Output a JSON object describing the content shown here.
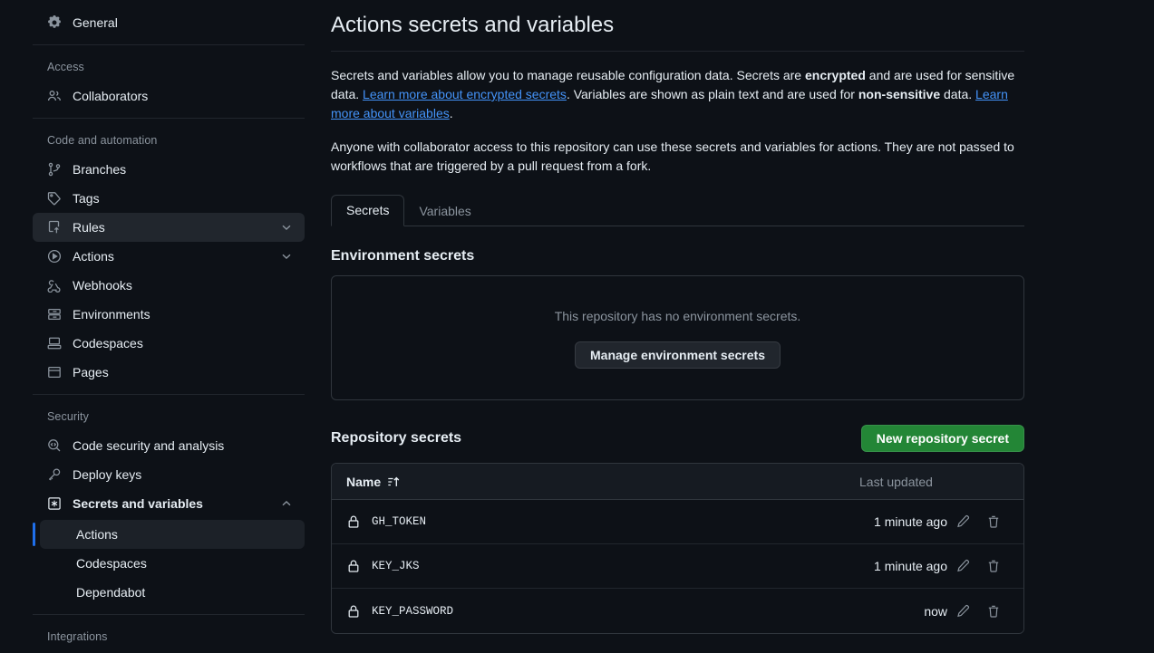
{
  "sidebar": {
    "top_items": [
      {
        "label": "General",
        "icon": "gear-icon"
      }
    ],
    "groups": [
      {
        "label": "Access",
        "items": [
          {
            "label": "Collaborators",
            "icon": "people-icon"
          }
        ]
      },
      {
        "label": "Code and automation",
        "items": [
          {
            "label": "Branches",
            "icon": "branch-icon"
          },
          {
            "label": "Tags",
            "icon": "tag-icon"
          },
          {
            "label": "Rules",
            "icon": "rules-icon",
            "chevron": "chevron-down-icon",
            "highlighted": true
          },
          {
            "label": "Actions",
            "icon": "play-icon",
            "chevron": "chevron-down-icon"
          },
          {
            "label": "Webhooks",
            "icon": "webhook-icon"
          },
          {
            "label": "Environments",
            "icon": "server-icon"
          },
          {
            "label": "Codespaces",
            "icon": "codespaces-icon"
          },
          {
            "label": "Pages",
            "icon": "browser-icon"
          }
        ]
      },
      {
        "label": "Security",
        "items": [
          {
            "label": "Code security and analysis",
            "icon": "codescan-icon"
          },
          {
            "label": "Deploy keys",
            "icon": "key-icon"
          },
          {
            "label": "Secrets and variables",
            "icon": "asterisk-icon",
            "chevron": "chevron-up-icon",
            "bold": true,
            "children": [
              {
                "label": "Actions",
                "selected": true
              },
              {
                "label": "Codespaces",
                "selected": false
              },
              {
                "label": "Dependabot",
                "selected": false
              }
            ]
          }
        ]
      },
      {
        "label": "Integrations",
        "items": []
      }
    ]
  },
  "main": {
    "title": "Actions secrets and variables",
    "paragraph1": {
      "part1": "Secrets and variables allow you to manage reusable configuration data. Secrets are ",
      "bold1": "encrypted",
      "part2": " and are used for sensitive data. ",
      "link1": "Learn more about encrypted secrets",
      "part3": ". Variables are shown as plain text and are used for ",
      "bold2": "non-sensitive",
      "part4": " data. ",
      "link2": "Learn more about variables",
      "part5": "."
    },
    "paragraph2": "Anyone with collaborator access to this repository can use these secrets and variables for actions. They are not passed to workflows that are triggered by a pull request from a fork.",
    "tabs": [
      {
        "label": "Secrets",
        "active": true
      },
      {
        "label": "Variables",
        "active": false
      }
    ],
    "environment_secrets": {
      "heading": "Environment secrets",
      "empty_text": "This repository has no environment secrets.",
      "button_label": "Manage environment secrets"
    },
    "repository_secrets": {
      "heading": "Repository secrets",
      "new_button_label": "New repository secret",
      "columns": {
        "name": "Name",
        "last_updated": "Last updated"
      },
      "sort_icon": "sort-asc-icon",
      "rows": [
        {
          "icon": "lock-icon",
          "name": "GH_TOKEN",
          "last_updated": "1 minute ago",
          "edit": "pencil-icon",
          "delete": "trash-icon"
        },
        {
          "icon": "lock-icon",
          "name": "KEY_JKS",
          "last_updated": "1 minute ago",
          "edit": "pencil-icon",
          "delete": "trash-icon"
        },
        {
          "icon": "lock-icon",
          "name": "KEY_PASSWORD",
          "last_updated": "now",
          "edit": "pencil-icon",
          "delete": "trash-icon"
        }
      ]
    }
  },
  "colors": {
    "background": "#0d1117",
    "border": "#30363d",
    "accent_blue": "#1f6feb",
    "link_blue": "#4493f8",
    "green_button": "#238636",
    "muted_text": "#8b949e"
  }
}
